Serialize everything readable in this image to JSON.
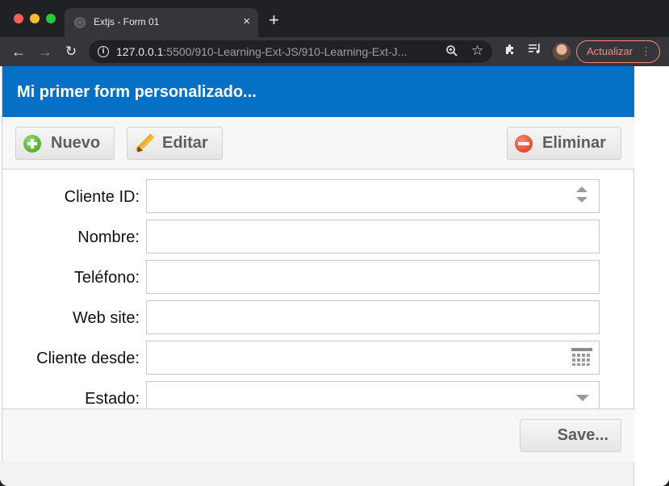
{
  "browser": {
    "tab_title": "Extjs - Form 01",
    "tab_close": "×",
    "new_tab": "+",
    "url_host": "127.0.0.1",
    "url_rest": ":5500/910-Learning-Ext-JS/910-Learning-Ext-J...",
    "update_label": "Actualizar",
    "menu_dots": "⋮"
  },
  "panel": {
    "title": "Mi primer form personalizado..."
  },
  "toolbar": {
    "nuevo_label": "Nuevo",
    "editar_label": "Editar",
    "eliminar_label": "Eliminar"
  },
  "form": {
    "fields": [
      {
        "label": "Cliente ID:",
        "value": "",
        "type": "number"
      },
      {
        "label": "Nombre:",
        "value": "",
        "type": "text"
      },
      {
        "label": "Teléfono:",
        "value": "",
        "type": "text"
      },
      {
        "label": "Web site:",
        "value": "",
        "type": "text"
      },
      {
        "label": "Cliente desde:",
        "value": "",
        "type": "date"
      },
      {
        "label": "Estado:",
        "value": "",
        "type": "combo"
      }
    ]
  },
  "footer": {
    "save_label": "Save..."
  },
  "colors": {
    "header_blue": "#0570c5",
    "update_button": "#f28b82"
  },
  "icons": [
    "back-arrow-icon",
    "forward-arrow-icon",
    "reload-icon",
    "info-icon",
    "zoom-icon",
    "star-icon",
    "extensions-icon",
    "playlist-icon",
    "add-icon",
    "pencil-icon",
    "delete-icon",
    "spinner-icon",
    "calendar-icon",
    "dropdown-arrow-icon"
  ]
}
